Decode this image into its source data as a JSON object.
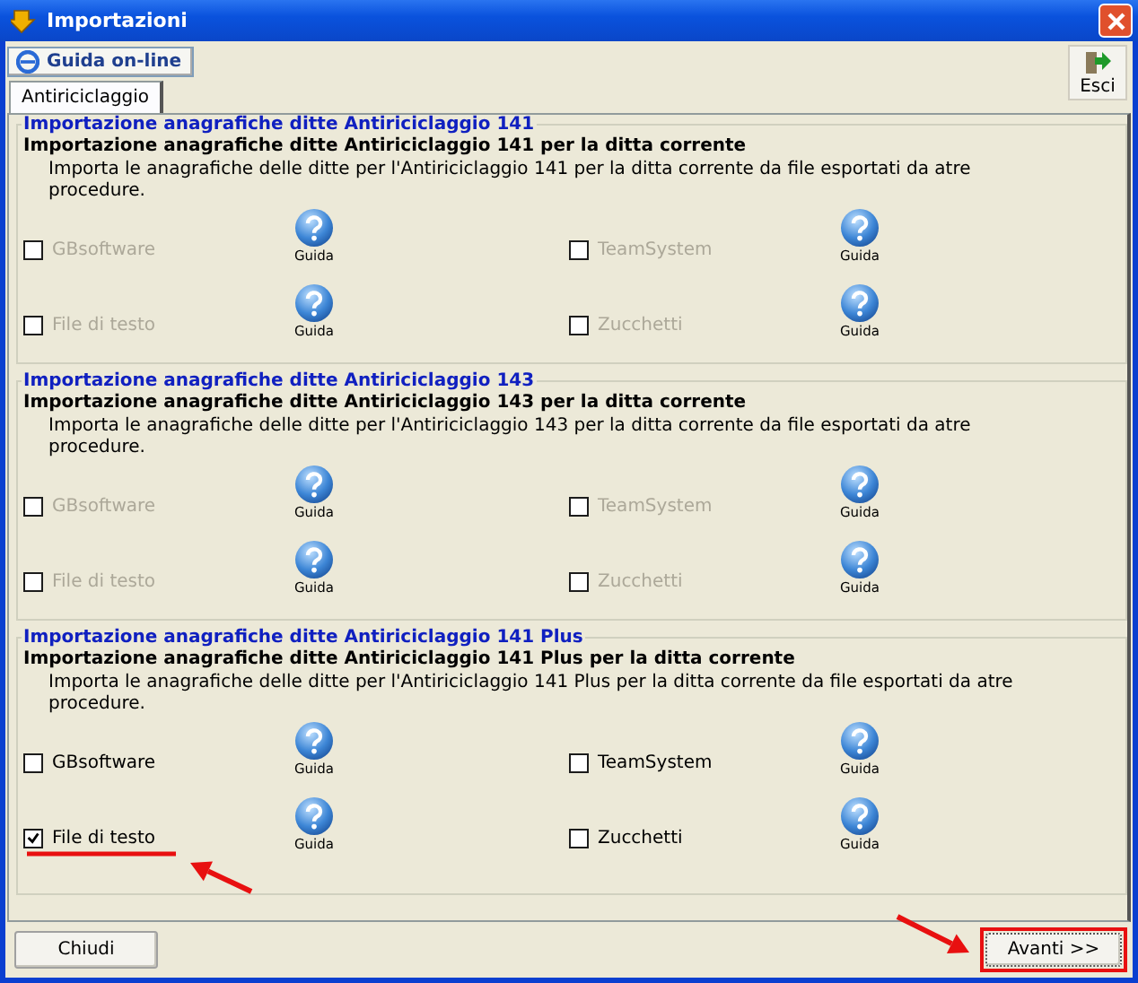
{
  "window": {
    "title": "Importazioni"
  },
  "toolbar": {
    "help_button": "Guida on-line",
    "exit_button": "Esci"
  },
  "tabs": [
    {
      "label": "Antiriciclaggio",
      "selected": true
    }
  ],
  "sections": [
    {
      "legend": "Importazione anagrafiche ditte Antiriciclaggio 141",
      "title": "Importazione anagrafiche ditte Antiriciclaggio 141 per la ditta corrente",
      "description": "Importa le anagrafiche delle ditte per l'Antiriciclaggio 141 per la ditta corrente da file esportati da atre procedure.",
      "options": [
        {
          "label": "GBsoftware",
          "checked": false,
          "disabled": true,
          "help": "Guida"
        },
        {
          "label": "TeamSystem",
          "checked": false,
          "disabled": true,
          "help": "Guida"
        },
        {
          "label": "File di testo",
          "checked": false,
          "disabled": true,
          "help": "Guida"
        },
        {
          "label": "Zucchetti",
          "checked": false,
          "disabled": true,
          "help": "Guida"
        }
      ]
    },
    {
      "legend": "Importazione anagrafiche ditte Antiriciclaggio 143",
      "title": "Importazione anagrafiche ditte Antiriciclaggio 143 per la ditta corrente",
      "description": "Importa le anagrafiche delle ditte per l'Antiriciclaggio 143 per la ditta corrente da file esportati da atre procedure.",
      "options": [
        {
          "label": "GBsoftware",
          "checked": false,
          "disabled": true,
          "help": "Guida"
        },
        {
          "label": "TeamSystem",
          "checked": false,
          "disabled": true,
          "help": "Guida"
        },
        {
          "label": "File di testo",
          "checked": false,
          "disabled": true,
          "help": "Guida"
        },
        {
          "label": "Zucchetti",
          "checked": false,
          "disabled": true,
          "help": "Guida"
        }
      ]
    },
    {
      "legend": "Importazione anagrafiche ditte Antiriciclaggio 141 Plus",
      "title": "Importazione anagrafiche ditte Antiriciclaggio 141 Plus per la ditta corrente",
      "description": "Importa le anagrafiche delle ditte per l'Antiriciclaggio 141 Plus per la ditta corrente da file esportati da atre procedure.",
      "options": [
        {
          "label": "GBsoftware",
          "checked": false,
          "disabled": false,
          "help": "Guida"
        },
        {
          "label": "TeamSystem",
          "checked": false,
          "disabled": false,
          "help": "Guida"
        },
        {
          "label": "File di testo",
          "checked": true,
          "disabled": false,
          "help": "Guida"
        },
        {
          "label": "Zucchetti",
          "checked": false,
          "disabled": false,
          "help": "Guida"
        }
      ]
    }
  ],
  "buttons": [
    {
      "label": "Chiudi",
      "highlighted": false
    },
    {
      "label": "Avanti >>",
      "highlighted": true
    }
  ],
  "annotations": [
    {
      "kind": "underline"
    },
    {
      "kind": "arrow"
    },
    {
      "kind": "arrow"
    }
  ]
}
